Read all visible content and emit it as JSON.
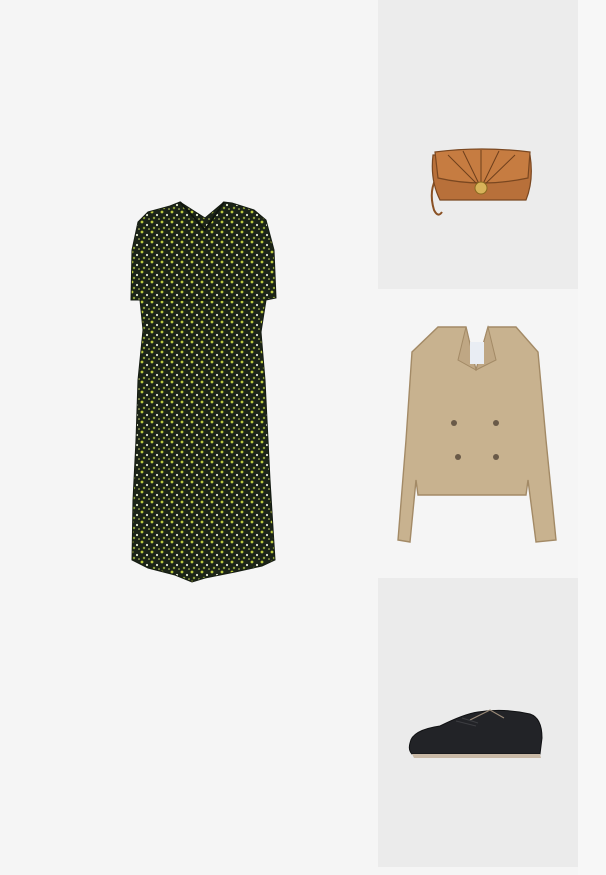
{
  "outfit": {
    "items": [
      {
        "id": "dress",
        "icon": "floral-midi-dress-image",
        "colors": {
          "base": "#1c2418",
          "print": "#b9c93e",
          "accent": "#f0f2e0"
        }
      },
      {
        "id": "bag",
        "icon": "tan-crossbody-bag-image",
        "colors": {
          "leather": "#b8703a",
          "hardware": "#d8b35a"
        }
      },
      {
        "id": "jacket",
        "icon": "beige-cropped-trench-jacket-image",
        "colors": {
          "fabric": "#c8b28f",
          "buttons": "#6a5a48"
        }
      },
      {
        "id": "shoes",
        "icon": "black-leather-oxford-shoe-image",
        "colors": {
          "leather": "#222327",
          "sole": "#c9b9a6"
        }
      }
    ]
  }
}
